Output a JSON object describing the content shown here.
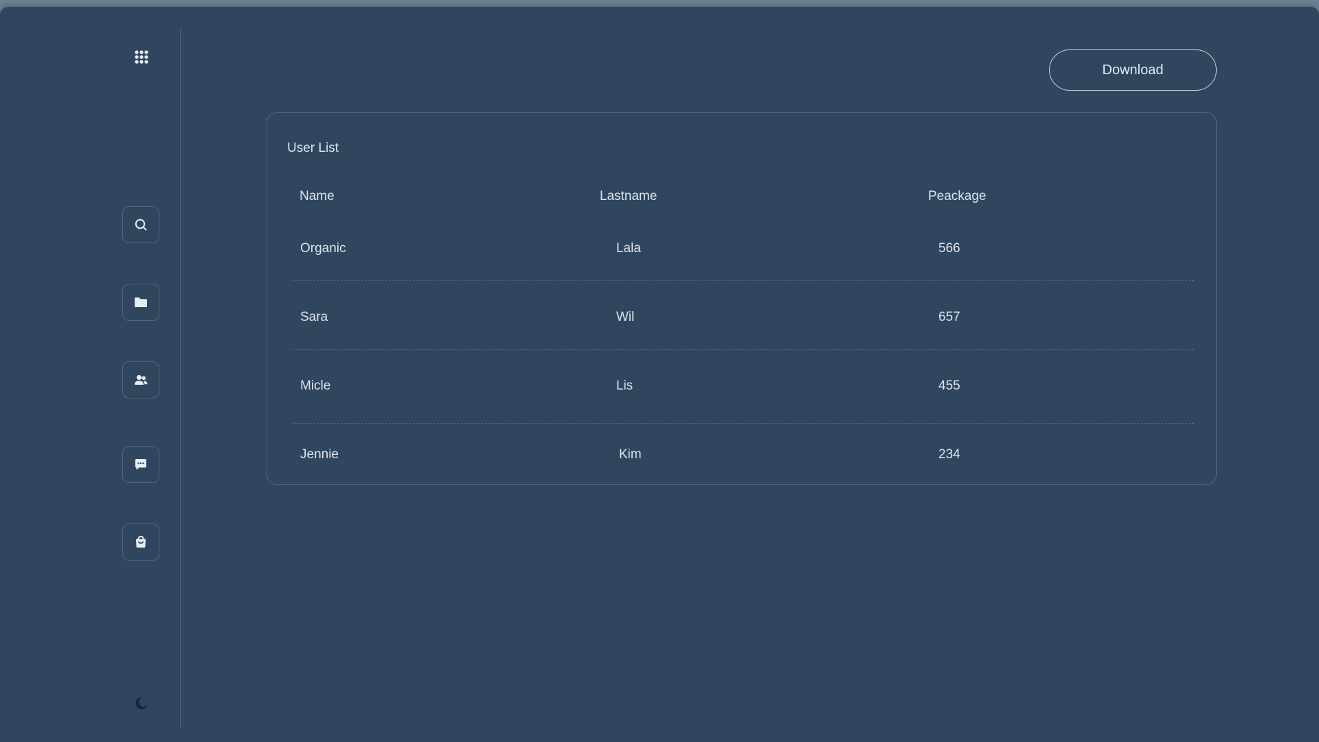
{
  "header": {
    "download_label": "Download"
  },
  "sidebar": {
    "items": [
      {
        "icon": "search-icon"
      },
      {
        "icon": "folder-icon"
      },
      {
        "icon": "users-icon"
      },
      {
        "icon": "chat-icon"
      },
      {
        "icon": "shopping-bag-icon"
      }
    ]
  },
  "table": {
    "title": "User List",
    "columns": [
      "Name",
      "Lastname",
      "Peackage"
    ],
    "rows": [
      {
        "name": "Organic",
        "lastname": "Lala",
        "package": "566"
      },
      {
        "name": "Sara",
        "lastname": "Wil",
        "package": "657"
      },
      {
        "name": "Micle",
        "lastname": "Lis",
        "package": "455"
      },
      {
        "name": "Jennie",
        "lastname": "Kim",
        "package": "234"
      }
    ]
  },
  "colors": {
    "background": "#30455e",
    "text": "#dde4ec",
    "border": "#52677f",
    "icon": "#e8eef5"
  }
}
